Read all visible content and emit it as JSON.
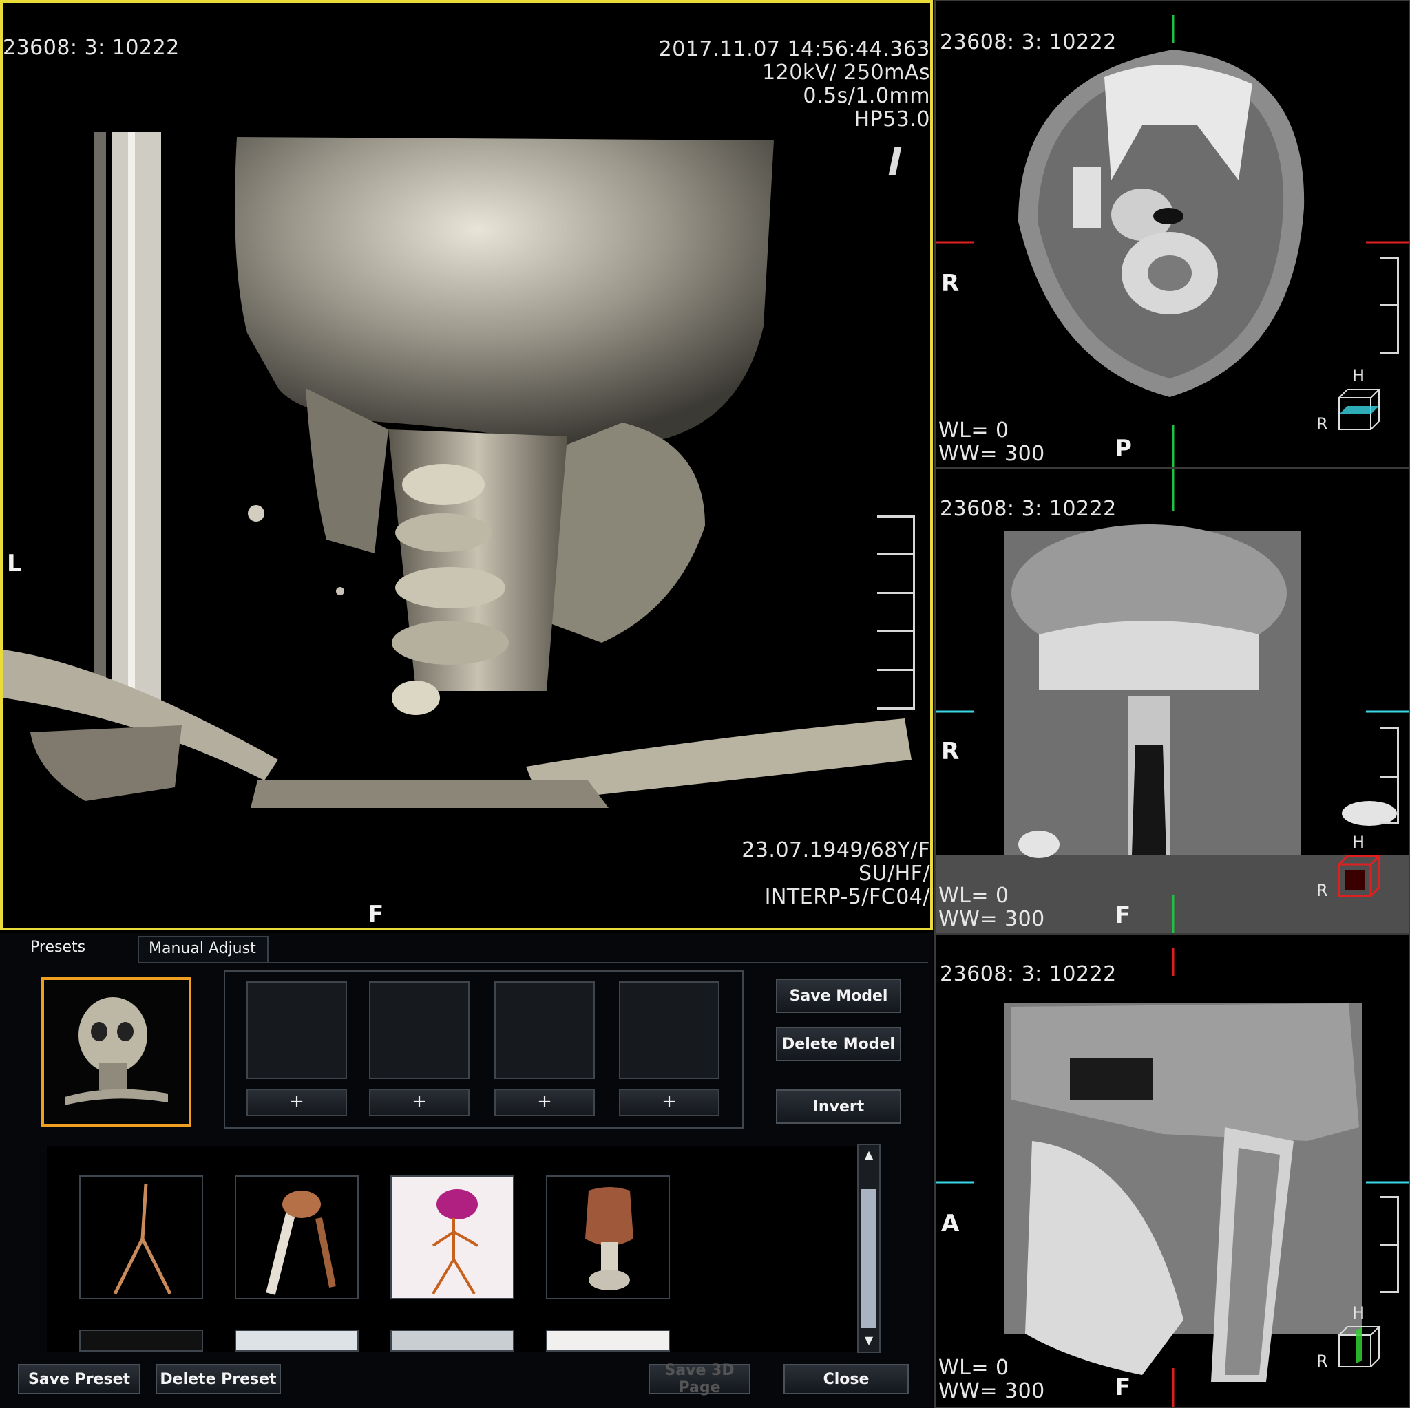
{
  "main_view": {
    "series_id": "23608: 3: 10222",
    "datetime": "2017.11.07 14:56:44.363",
    "exposure": "120kV/ 250mAs",
    "timing": "0.5s/1.0mm",
    "kernel": "HP53.0",
    "patient_info": "23.07.1949/68Y/F",
    "orientation_info": "SU/HF/",
    "recon": "INTERP-5/FC04/",
    "label_left": "L",
    "label_bottom": "F"
  },
  "axial_view": {
    "series_id": "23608: 3: 10222",
    "label_left": "R",
    "label_bottom": "P",
    "wl": "WL= 0",
    "ww": "WW= 300",
    "cube_top": "H",
    "cube_left": "R"
  },
  "coronal_view": {
    "series_id": "23608: 3: 10222",
    "label_left": "R",
    "label_bottom": "F",
    "wl": "WL= 0",
    "ww": "WW= 300",
    "cube_top": "H",
    "cube_left": "R"
  },
  "sagittal_view": {
    "series_id": "23608: 3: 10222",
    "label_left": "A",
    "label_bottom": "F",
    "wl": "WL= 0",
    "ww": "WW= 300",
    "cube_top": "H",
    "cube_left": "R"
  },
  "panel": {
    "tabs": [
      "Presets",
      "Manual Adjust"
    ],
    "active_tab": "Presets",
    "plus_label": "+",
    "buttons": {
      "save_model": "Save Model",
      "delete_model": "Delete Model",
      "invert": "Invert",
      "save_preset": "Save Preset",
      "delete_preset": "Delete Preset",
      "save_3d_page": "Save 3D Page",
      "close": "Close"
    }
  },
  "colors": {
    "active_viewport_border": "#e9dc3a",
    "selected_preset_border": "#f0a020",
    "axial_cube": "#3ad7e6",
    "coronal_cube": "#e02020",
    "sagittal_cube": "#30d030"
  }
}
